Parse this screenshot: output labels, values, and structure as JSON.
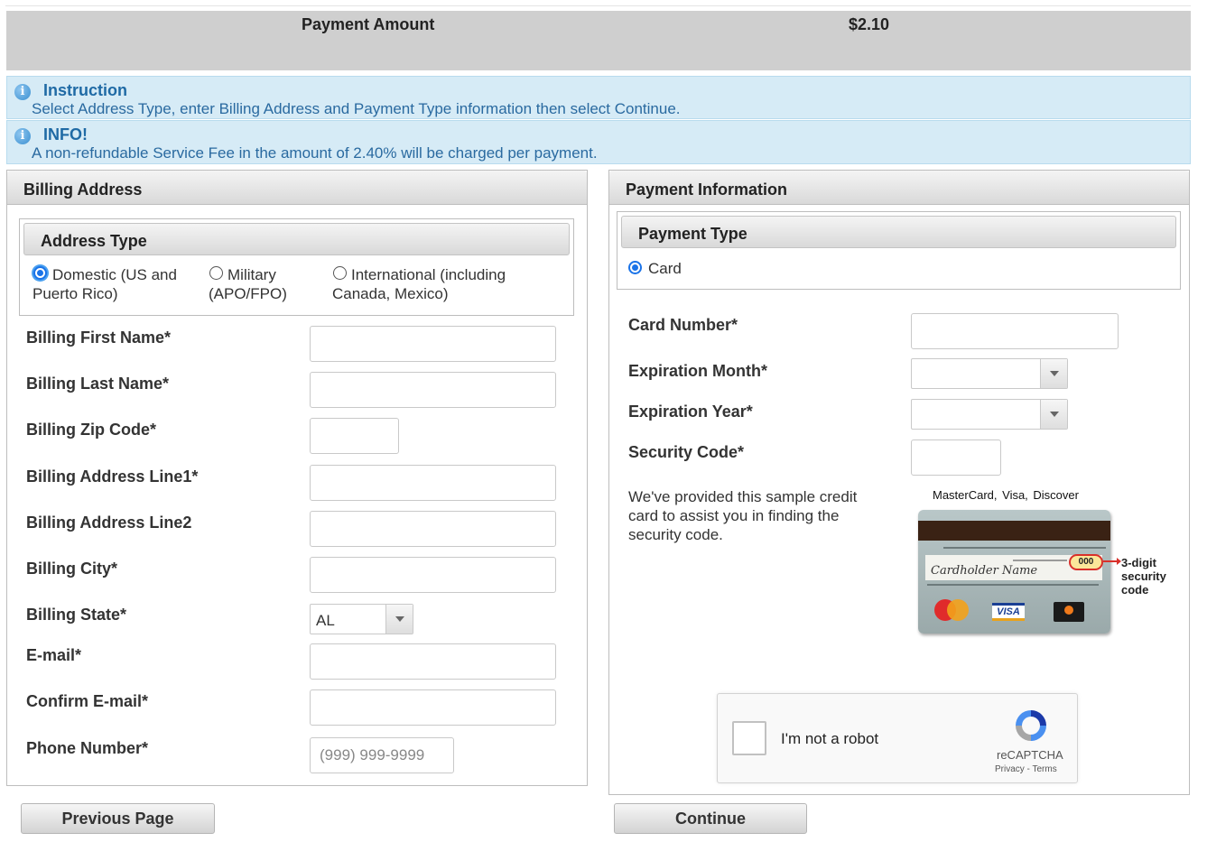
{
  "payment": {
    "label": "Payment Amount",
    "amount": "$2.10"
  },
  "alerts": [
    {
      "title": "Instruction",
      "text": "Select Address Type, enter Billing Address and Payment Type information then select Continue."
    },
    {
      "title": "INFO!",
      "text": "A non-refundable Service Fee in the amount of 2.40% will be charged per payment."
    }
  ],
  "billing": {
    "title": "Billing Address",
    "address_type": {
      "title": "Address Type",
      "options": [
        {
          "line1": "Domestic (US and",
          "line2": "Puerto Rico)",
          "selected": true
        },
        {
          "line1": "Military",
          "line2": "(APO/FPO)",
          "selected": false
        },
        {
          "line1": "International (including",
          "line2": "Canada, Mexico)",
          "selected": false
        }
      ]
    },
    "fields": {
      "first_name": {
        "label": "Billing First Name*",
        "value": ""
      },
      "last_name": {
        "label": "Billing Last Name*",
        "value": ""
      },
      "zip": {
        "label": "Billing Zip Code*",
        "value": ""
      },
      "line1": {
        "label": "Billing Address Line1*",
        "value": ""
      },
      "line2": {
        "label": "Billing Address Line2",
        "value": ""
      },
      "city": {
        "label": "Billing City*",
        "value": ""
      },
      "state": {
        "label": "Billing State*",
        "value": "AL"
      },
      "email": {
        "label": "E-mail*",
        "value": ""
      },
      "confirm_email": {
        "label": "Confirm E-mail*",
        "value": ""
      },
      "phone": {
        "label": "Phone Number*",
        "value": "",
        "placeholder": "(999) 999-9999"
      }
    }
  },
  "payment_info": {
    "title": "Payment Information",
    "payment_type": {
      "title": "Payment Type",
      "option": "Card",
      "selected": true
    },
    "fields": {
      "card_number": {
        "label": "Card Number*",
        "value": ""
      },
      "exp_month": {
        "label": "Expiration Month*",
        "value": ""
      },
      "exp_year": {
        "label": "Expiration Year*",
        "value": ""
      },
      "security_code": {
        "label": "Security Code*",
        "value": ""
      }
    },
    "sample_text": [
      "We've provided this sample credit",
      "card to assist you in finding the",
      "security code."
    ],
    "card_image": {
      "legend": "MasterCard,  Visa,  Discover",
      "signature": "Cardholder Name",
      "code": "000",
      "callout": [
        "3-digit",
        "security",
        "code"
      ],
      "visa_label": "VISA",
      "colors": {
        "stripe": "#3a2214",
        "card": "#a9b8b9",
        "highlight": "#d9302a"
      }
    }
  },
  "captcha": {
    "label": "I'm not a robot",
    "brand": "reCAPTCHA",
    "terms": "Privacy - Terms"
  },
  "buttons": {
    "previous": "Previous Page",
    "continue": "Continue"
  },
  "colors": {
    "alert_bg": "#d6ebf6",
    "alert_text": "#2a6aa0",
    "amount_bar": "#cfcfcf",
    "radio_accent": "#1a73e8"
  }
}
